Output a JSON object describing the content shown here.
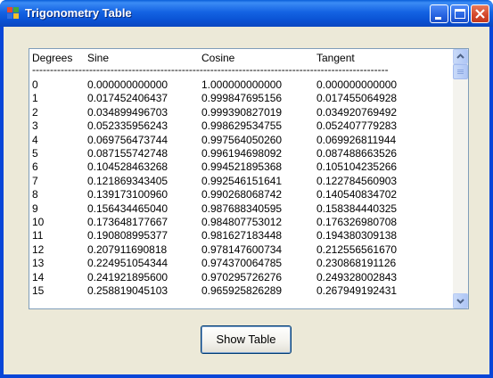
{
  "window": {
    "title": "Trigonometry Table",
    "controls": {
      "minimize": "minimize-icon",
      "maximize": "maximize-icon",
      "close": "close-icon"
    }
  },
  "table": {
    "headers": [
      "Degrees",
      "Sine",
      "Cosine",
      "Tangent"
    ],
    "separator": "----------------------------------------------------------------------------------------------------",
    "rows": [
      [
        "0",
        "0.000000000000",
        "1.000000000000",
        "0.000000000000"
      ],
      [
        "1",
        "0.017452406437",
        "0.999847695156",
        "0.017455064928"
      ],
      [
        "2",
        "0.034899496703",
        "0.999390827019",
        "0.034920769492"
      ],
      [
        "3",
        "0.052335956243",
        "0.998629534755",
        "0.052407779283"
      ],
      [
        "4",
        "0.069756473744",
        "0.997564050260",
        "0.069926811944"
      ],
      [
        "5",
        "0.087155742748",
        "0.996194698092",
        "0.087488663526"
      ],
      [
        "6",
        "0.104528463268",
        "0.994521895368",
        "0.105104235266"
      ],
      [
        "7",
        "0.121869343405",
        "0.992546151641",
        "0.122784560903"
      ],
      [
        "8",
        "0.139173100960",
        "0.990268068742",
        "0.140540834702"
      ],
      [
        "9",
        "0.156434465040",
        "0.987688340595",
        "0.158384440325"
      ],
      [
        "10",
        "0.173648177667",
        "0.984807753012",
        "0.176326980708"
      ],
      [
        "11",
        "0.190808995377",
        "0.981627183448",
        "0.194380309138"
      ],
      [
        "12",
        "0.207911690818",
        "0.978147600734",
        "0.212556561670"
      ],
      [
        "13",
        "0.224951054344",
        "0.974370064785",
        "0.230868191126"
      ],
      [
        "14",
        "0.241921895600",
        "0.970295726276",
        "0.249328002843"
      ],
      [
        "15",
        "0.258819045103",
        "0.965925826289",
        "0.267949192431"
      ]
    ]
  },
  "buttons": {
    "show_table": "Show Table"
  },
  "colors": {
    "titlebar": "#0a52d4",
    "client_background": "#ece9d8",
    "listbox_border": "#7f9db9",
    "scrollbar_button": "#bcd0f7",
    "close_button": "#d2462a"
  },
  "icons": {
    "app": "app-window-icon",
    "scroll_up": "scroll-up-arrow-icon",
    "scroll_down": "scroll-down-arrow-icon"
  }
}
